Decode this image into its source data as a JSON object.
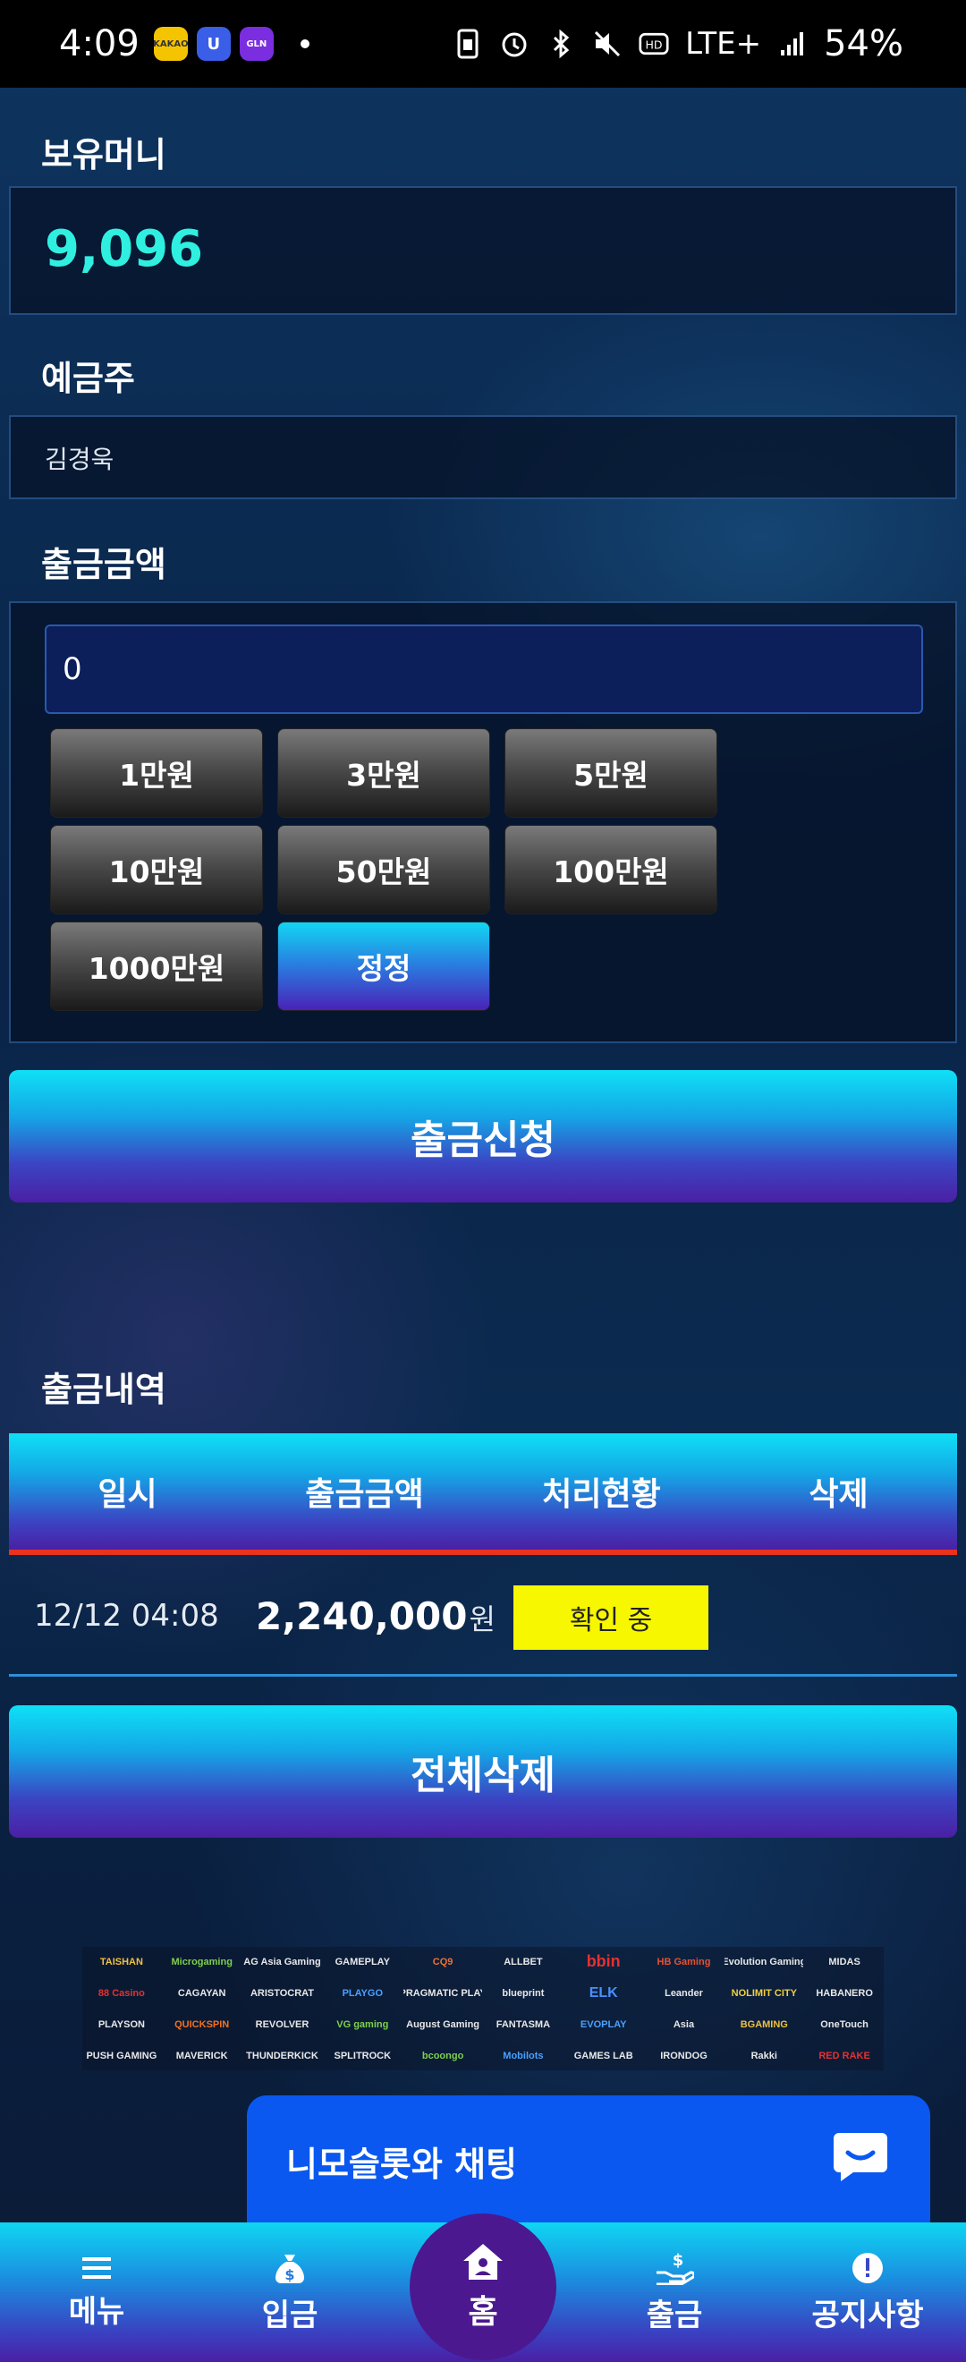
{
  "status_bar": {
    "time": "4:09",
    "apps": [
      "KAKAO",
      "U",
      "GLN"
    ],
    "network": "LTE+",
    "battery": "54%"
  },
  "balance": {
    "label": "보유머니",
    "value": "9,096"
  },
  "depositor": {
    "label": "예금주",
    "value": "김경욱"
  },
  "withdraw_amount": {
    "label": "출금금액",
    "value": "0",
    "chips": [
      "1만원",
      "3만원",
      "5만원",
      "10만원",
      "50만원",
      "100만원",
      "1000만원"
    ],
    "reset_label": "정정"
  },
  "submit_label": "출금신청",
  "history": {
    "title": "출금내역",
    "columns": [
      "일시",
      "출금금액",
      "처리현황",
      "삭제"
    ],
    "rows": [
      {
        "date": "12/12 04:08",
        "amount": "2,240,000",
        "unit": "원",
        "status": "확인 중"
      }
    ]
  },
  "delete_all_label": "전체삭제",
  "providers": [
    "TAISHAN",
    "Microgaming",
    "AG Asia Gaming",
    "GAMEPLAY",
    "CQ9",
    "ALLBET",
    "bbin",
    "HB Gaming",
    "Evolution Gaming",
    "MIDAS",
    "88 Casino",
    "CAGAYAN",
    "ARISTOCRAT",
    "PLAYGO",
    "PRAGMATIC PLAY",
    "blueprint",
    "ELK",
    "Leander",
    "NOLIMIT CITY",
    "HABANERO",
    "PLAYSON",
    "QUICKSPIN",
    "REVOLVER",
    "VG gaming",
    "August Gaming",
    "FANTASMA",
    "EVOPLAY",
    "Asia",
    "BGAMING",
    "OneTouch",
    "PUSH GAMING",
    "MAVERICK",
    "THUNDERKICK",
    "SPLITROCK",
    "bcoongo",
    "Mobilots",
    "GAMES LAB",
    "IRONDOG",
    "Rakki",
    "RED RAKE"
  ],
  "chat": {
    "label": "니모슬롯와 채팅"
  },
  "bottom_nav": {
    "menu": "메뉴",
    "deposit": "입금",
    "home": "홈",
    "withdraw": "출금",
    "notice": "공지사항"
  }
}
